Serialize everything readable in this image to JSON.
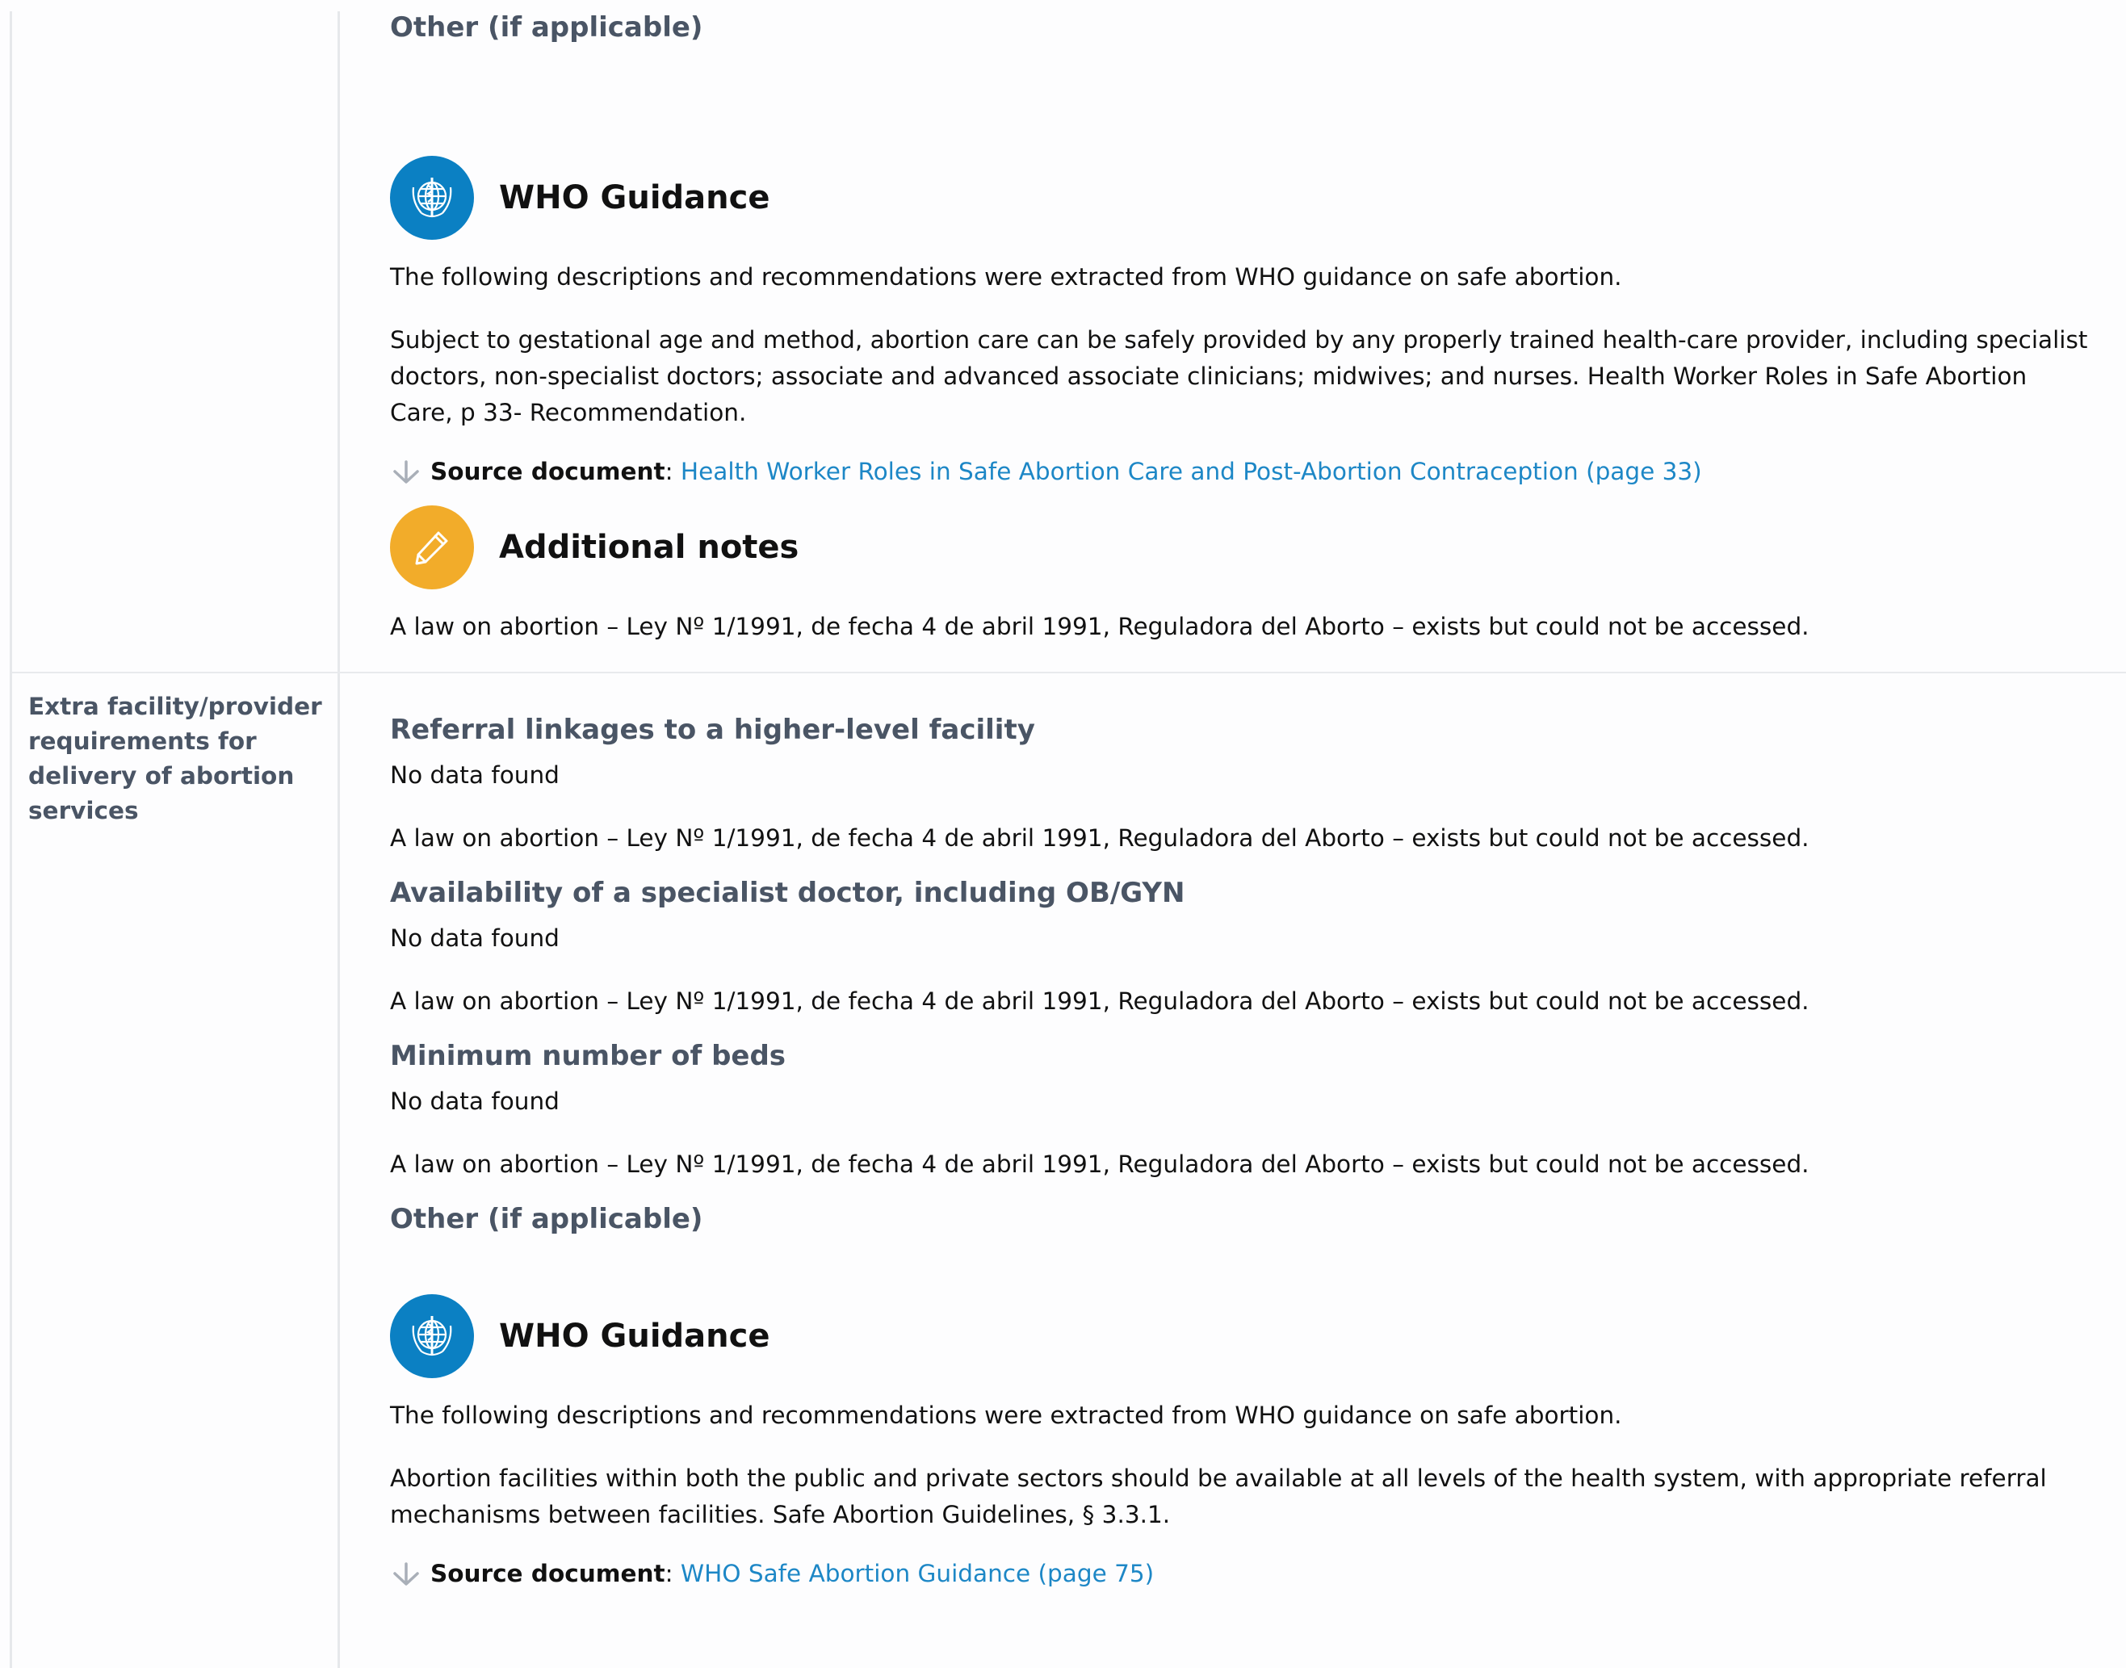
{
  "top_block": {
    "other_heading": "Other (if applicable)",
    "who": {
      "title": "WHO Guidance",
      "intro": "The following descriptions and recommendations were extracted from WHO guidance on safe abortion.",
      "body_line1": "Subject to gestational age and method, abortion care can be safely provided by any properly trained health-care provider, including specialist",
      "body_line2": "doctors, non-specialist doctors; associate and advanced associate clinicians; midwives; and nurses. Health Worker Roles in Safe Abortion",
      "body_line3": "Care, p 33- Recommendation.",
      "source_label": "Source document",
      "source_sep": ":",
      "source_link": "Health Worker Roles in Safe Abortion Care and Post-Abortion Contraception (page 33)"
    },
    "notes": {
      "title": "Additional notes",
      "text": "A law on abortion – Ley Nº 1/1991, de fecha 4 de abril 1991, Reguladora del Aborto – exists but could not be accessed."
    }
  },
  "section2": {
    "label": "Extra facility/provider requirements for delivery of abortion services",
    "items": [
      {
        "heading": "Referral linkages to a higher-level facility",
        "status": "No data found",
        "note": "A law on abortion – Ley Nº 1/1991, de fecha 4 de abril 1991, Reguladora del Aborto – exists but could not be accessed."
      },
      {
        "heading": "Availability of a specialist doctor, including OB/GYN",
        "status": "No data found",
        "note": "A law on abortion – Ley Nº 1/1991, de fecha 4 de abril 1991, Reguladora del Aborto – exists but could not be accessed."
      },
      {
        "heading": "Minimum number of beds",
        "status": "No data found",
        "note": "A law on abortion – Ley Nº 1/1991, de fecha 4 de abril 1991, Reguladora del Aborto – exists but could not be accessed."
      }
    ],
    "other_heading": "Other (if applicable)",
    "who": {
      "title": "WHO Guidance",
      "intro": "The following descriptions and recommendations were extracted from WHO guidance on safe abortion.",
      "body_line1": "Abortion facilities within both the public and private sectors should be available at all levels of the health system, with appropriate referral",
      "body_line2": "mechanisms between facilities. Safe Abortion Guidelines, § 3.3.1.",
      "source_label": "Source document",
      "source_sep": ":",
      "source_link": "WHO Safe Abortion Guidance (page 75)"
    }
  },
  "icons": {
    "who_logo": "who-emblem-icon",
    "notes": "pencil-icon",
    "source": "down-arrow-icon"
  },
  "colors": {
    "who_blue": "#0b80c3",
    "notes_orange": "#f2ac2a",
    "link": "#1d87c6",
    "heading_gray": "#4a5565"
  }
}
